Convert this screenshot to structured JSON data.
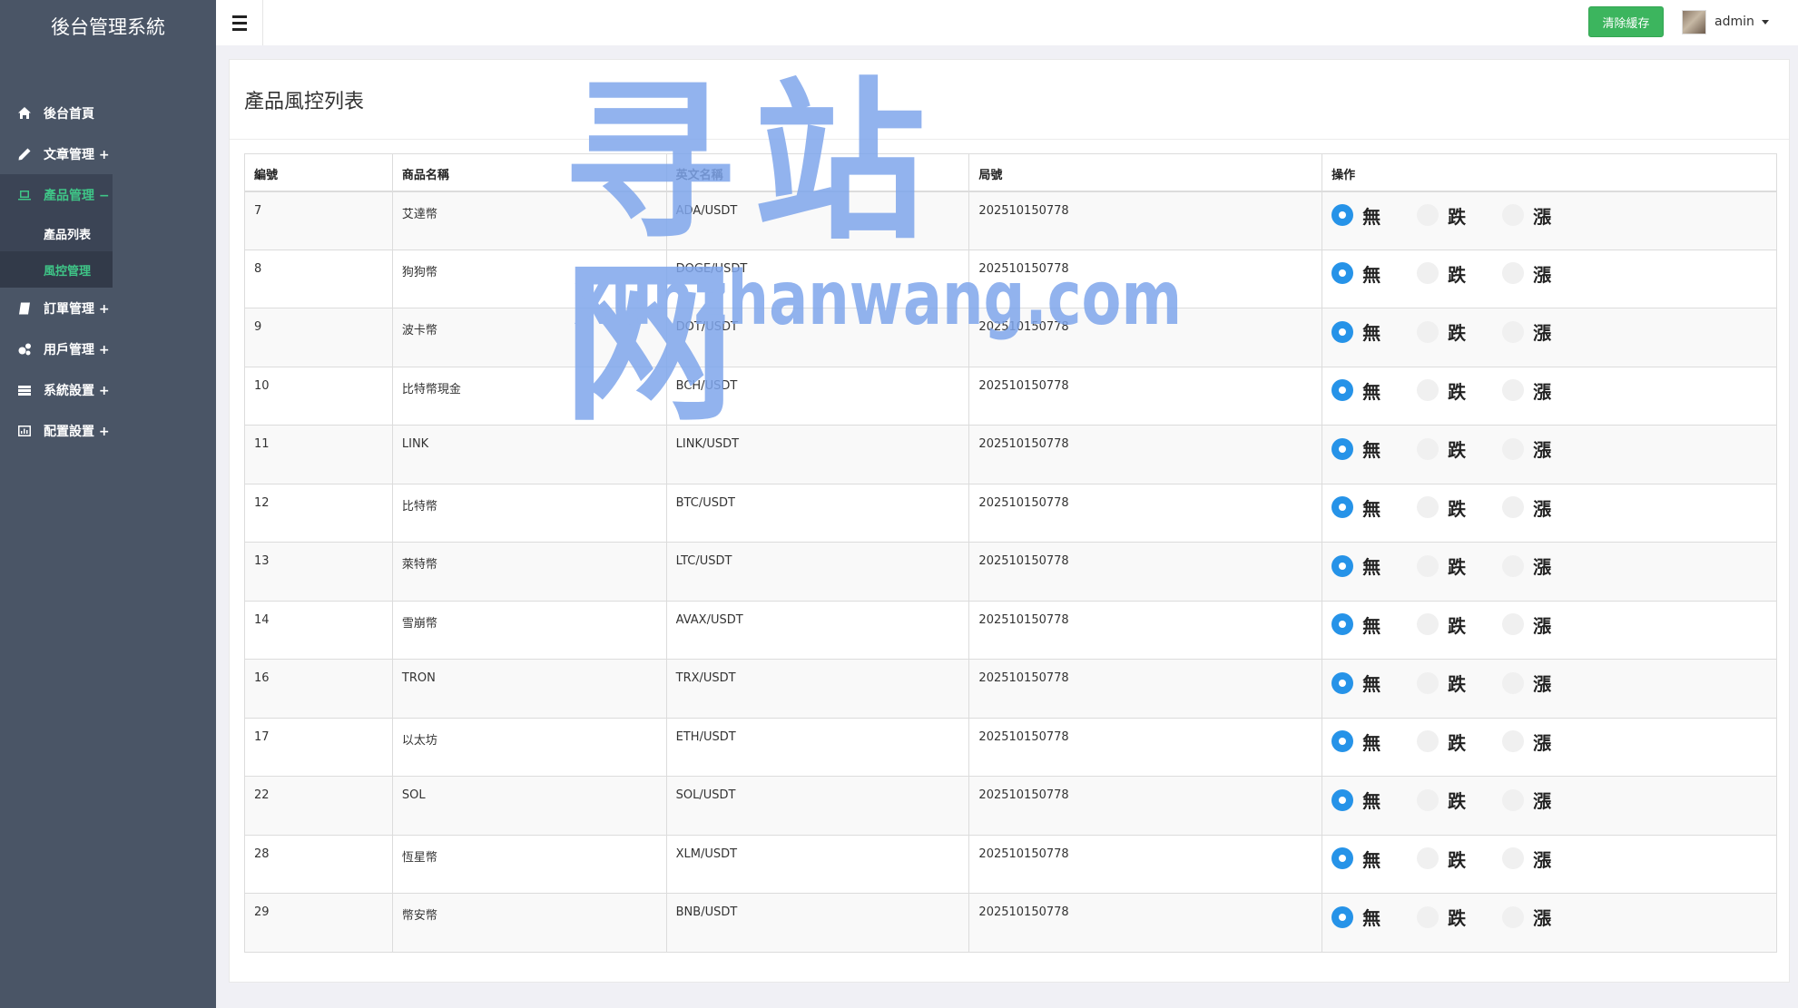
{
  "app": {
    "title": "後台管理系統"
  },
  "sidebar": {
    "items": [
      {
        "label": "後台首頁",
        "icon": "home-icon"
      },
      {
        "label": "文章管理 +",
        "icon": "pencil-icon"
      },
      {
        "label": "產品管理 −",
        "icon": "laptop-icon",
        "open": true,
        "children": [
          {
            "label": "產品列表"
          },
          {
            "label": "風控管理",
            "active": true
          }
        ]
      },
      {
        "label": "訂單管理 +",
        "icon": "book-icon"
      },
      {
        "label": "用戶管理 +",
        "icon": "gears-icon"
      },
      {
        "label": "系統設置 +",
        "icon": "server-icon"
      },
      {
        "label": "配置設置 +",
        "icon": "chart-icon"
      }
    ]
  },
  "topbar": {
    "clear_cache_label": "清除緩存",
    "user_name": "admin"
  },
  "page": {
    "title": "產品風控列表"
  },
  "table": {
    "headers": [
      "編號",
      "商品名稱",
      "英文名稱",
      "局號",
      "操作"
    ],
    "options": [
      "無",
      "跌",
      "漲"
    ],
    "rows": [
      {
        "id": "7",
        "name": "艾達幣",
        "en": "ADA/USDT",
        "period": "202510150778",
        "selected": "無"
      },
      {
        "id": "8",
        "name": "狗狗幣",
        "en": "DOGE/USDT",
        "period": "202510150778",
        "selected": "無"
      },
      {
        "id": "9",
        "name": "波卡幣",
        "en": "DOT/USDT",
        "period": "202510150778",
        "selected": "無"
      },
      {
        "id": "10",
        "name": "比特幣現金",
        "en": "BCH/USDT",
        "period": "202510150778",
        "selected": "無"
      },
      {
        "id": "11",
        "name": "LINK",
        "en": "LINK/USDT",
        "period": "202510150778",
        "selected": "無"
      },
      {
        "id": "12",
        "name": "比特幣",
        "en": "BTC/USDT",
        "period": "202510150778",
        "selected": "無"
      },
      {
        "id": "13",
        "name": "萊特幣",
        "en": "LTC/USDT",
        "period": "202510150778",
        "selected": "無"
      },
      {
        "id": "14",
        "name": "雪崩幣",
        "en": "AVAX/USDT",
        "period": "202510150778",
        "selected": "無"
      },
      {
        "id": "16",
        "name": "TRON",
        "en": "TRX/USDT",
        "period": "202510150778",
        "selected": "無"
      },
      {
        "id": "17",
        "name": "以太坊",
        "en": "ETH/USDT",
        "period": "202510150778",
        "selected": "無"
      },
      {
        "id": "22",
        "name": "SOL",
        "en": "SOL/USDT",
        "period": "202510150778",
        "selected": "無"
      },
      {
        "id": "28",
        "name": "恆星幣",
        "en": "XLM/USDT",
        "period": "202510150778",
        "selected": "無"
      },
      {
        "id": "29",
        "name": "幣安幣",
        "en": "BNB/USDT",
        "period": "202510150778",
        "selected": "無"
      }
    ]
  },
  "watermark": {
    "line1": "寻站网",
    "line2": "xunzhanwang.com"
  },
  "colors": {
    "sidebar": "#4a5566",
    "accent_green": "#3fc587",
    "button_green": "#3cb55e",
    "radio_blue": "#2693e8"
  }
}
